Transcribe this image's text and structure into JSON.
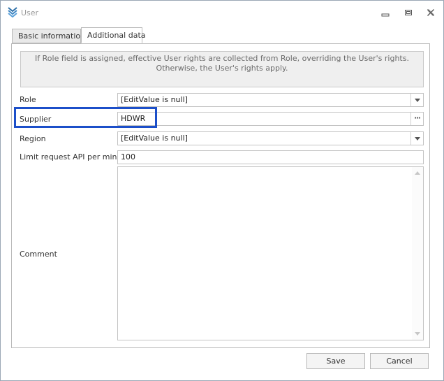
{
  "window": {
    "title": "User",
    "accent_color": "#1c4fc9"
  },
  "tabs": [
    {
      "label": "Basic information",
      "selected": false
    },
    {
      "label": "Additional data",
      "selected": true
    }
  ],
  "info": {
    "line1": "If Role field is assigned, effective User rights are collected from Role, overriding the User's rights.",
    "line2": "Otherwise, the User's rights apply."
  },
  "form": {
    "role": {
      "label": "Role",
      "value": "[EditValue is null]"
    },
    "supplier": {
      "label": "Supplier",
      "value": "HDWR",
      "button": "···"
    },
    "region": {
      "label": "Region",
      "value": "[EditValue is null]"
    },
    "limit": {
      "label": "Limit request API per minute",
      "value": "100"
    },
    "comment": {
      "label": "Comment",
      "value": ""
    }
  },
  "buttons": {
    "save": "Save",
    "cancel": "Cancel"
  },
  "icons": {
    "app": "chevrons-down-icon",
    "minimize": "minimize-icon",
    "maximize": "restore-icon",
    "close": "close-icon",
    "dropdown": "chevron-down-icon",
    "ellipsis": "ellipsis-icon"
  }
}
